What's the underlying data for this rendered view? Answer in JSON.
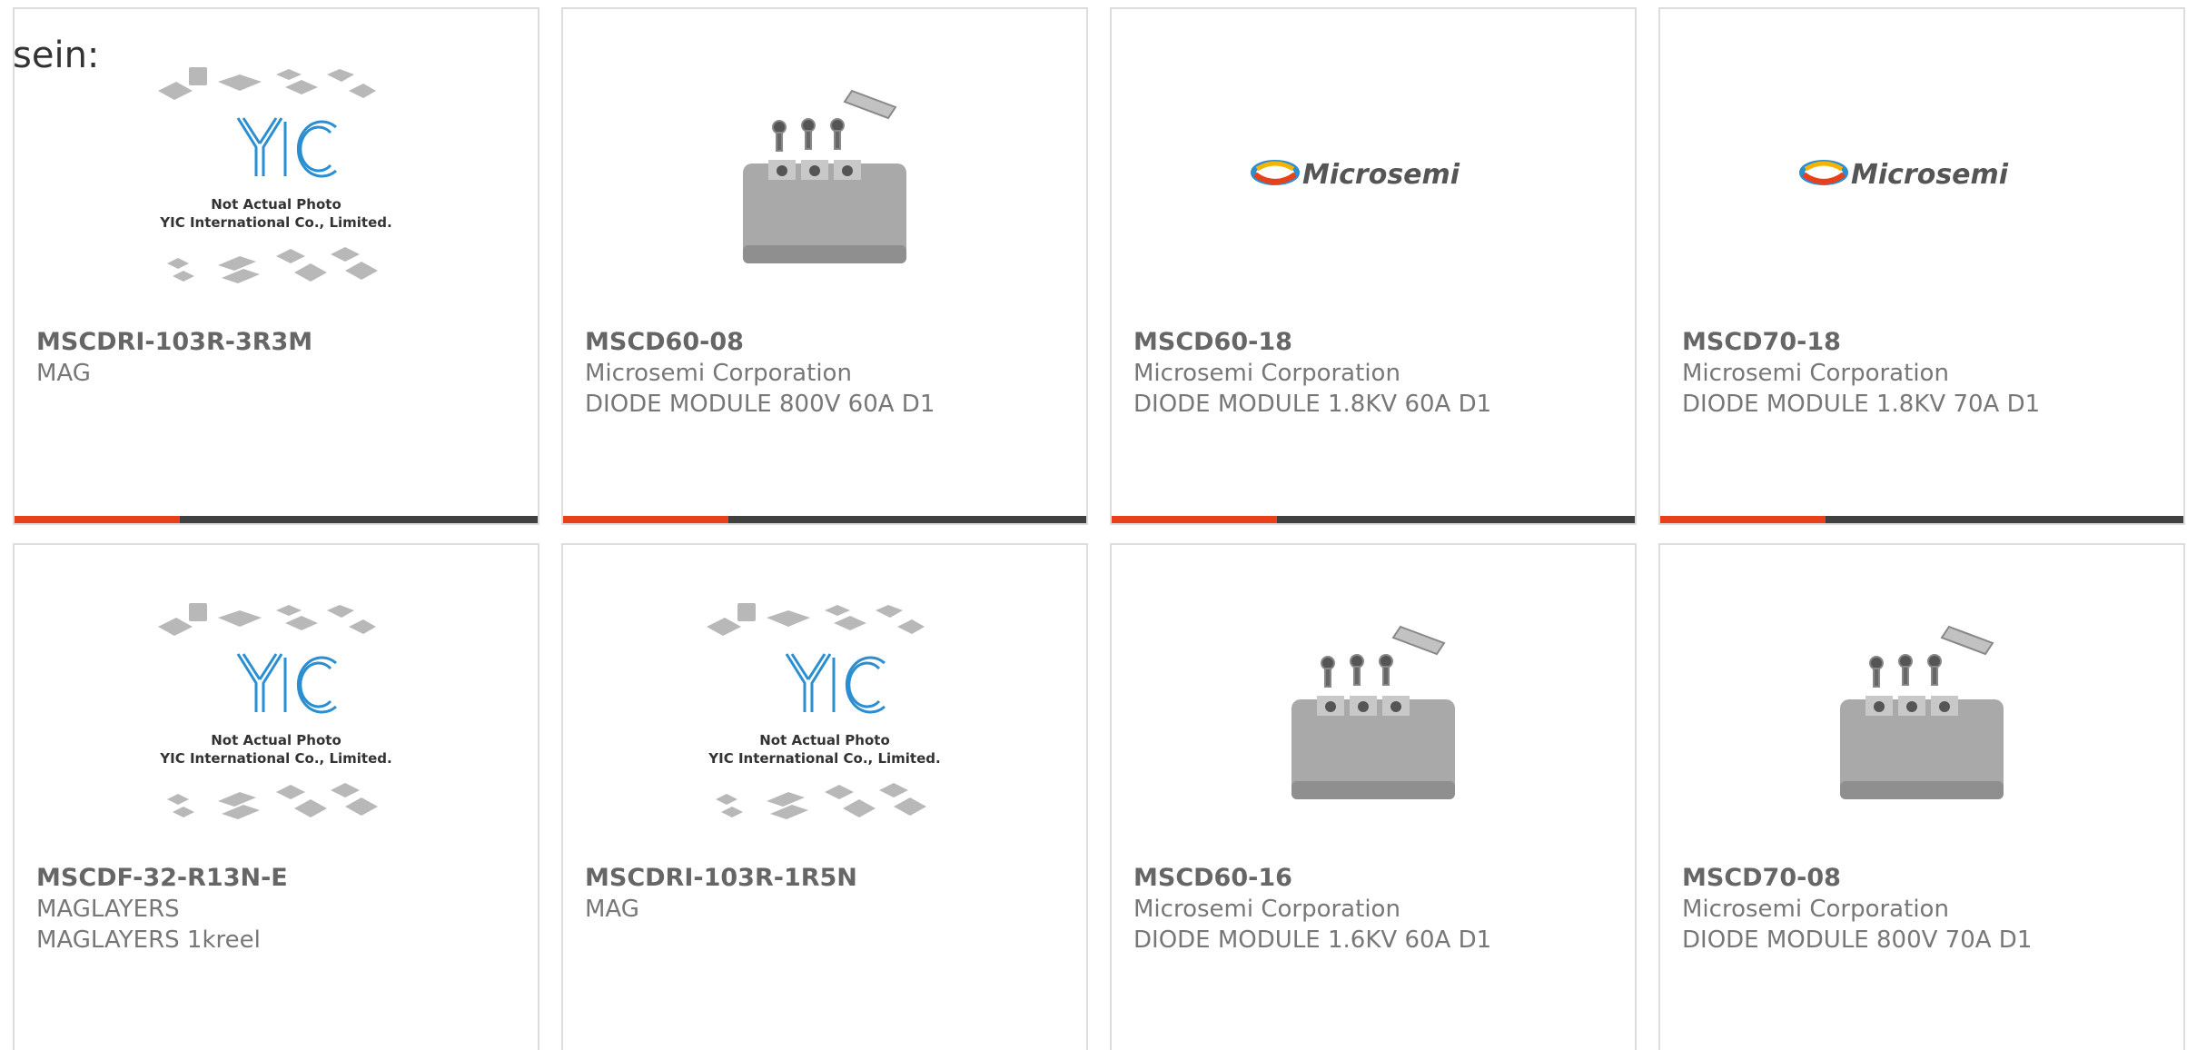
{
  "intro": {
    "text": "sein:"
  },
  "colors": {
    "accent": "#e8401a",
    "bar": "#404040",
    "border": "#dddddd"
  },
  "products": [
    {
      "part_no": "MSCDRI-103R-3R3M",
      "maker": "MAG",
      "description": "",
      "image": "yic-placeholder-icon"
    },
    {
      "part_no": "MSCD60-08",
      "maker": "Microsemi Corporation",
      "description": "DIODE MODULE 800V 60A D1",
      "image": "diode-module-photo"
    },
    {
      "part_no": "MSCD60-18",
      "maker": "Microsemi Corporation",
      "description": "DIODE MODULE 1.8KV 60A D1",
      "image": "microsemi-logo"
    },
    {
      "part_no": "MSCD70-18",
      "maker": "Microsemi Corporation",
      "description": "DIODE MODULE 1.8KV 70A D1",
      "image": "microsemi-logo"
    },
    {
      "part_no": "MSCDF-32-R13N-E",
      "maker": "MAGLAYERS",
      "description": "MAGLAYERS 1kreel",
      "image": "yic-placeholder-icon"
    },
    {
      "part_no": "MSCDRI-103R-1R5N",
      "maker": "MAG",
      "description": "",
      "image": "yic-placeholder-icon"
    },
    {
      "part_no": "MSCD60-16",
      "maker": "Microsemi Corporation",
      "description": "DIODE MODULE 1.6KV 60A D1",
      "image": "diode-module-photo"
    },
    {
      "part_no": "MSCD70-08",
      "maker": "Microsemi Corporation",
      "description": "DIODE MODULE 800V 70A D1",
      "image": "diode-module-photo"
    }
  ],
  "placeholder": {
    "line1": "Not Actual Photo",
    "line2": "YIC International Co., Limited.",
    "logo_text": "YIC"
  },
  "brand": {
    "microsemi": "Microsemi"
  }
}
